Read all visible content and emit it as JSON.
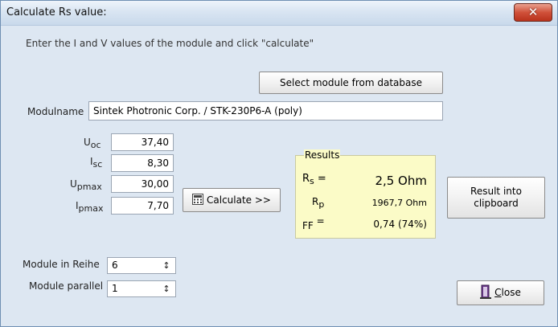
{
  "window": {
    "title": "Calculate Rs value:"
  },
  "instruction": "Enter the I and V values of the module and click \"calculate\"",
  "buttons": {
    "select_module": "Select module from database",
    "calculate": "Calculate >>",
    "result_clipboard_line1": "Result into",
    "result_clipboard_line2": "clipboard",
    "close": "Close",
    "close_mnemonic": "C",
    "close_rest": "lose"
  },
  "module": {
    "label": "Modulname",
    "value": "Sintek Photronic Corp. / STK-230P6-A (poly)"
  },
  "inputs": {
    "uoc": {
      "main": "U",
      "sub": "oc",
      "value": "37,40"
    },
    "isc": {
      "main": "I",
      "sub": "sc",
      "value": "8,30"
    },
    "upmax": {
      "main": "U",
      "sub": "pmax",
      "value": "30,00"
    },
    "ipmax": {
      "main": "I",
      "sub": "pmax",
      "value": "7,70"
    }
  },
  "results": {
    "title": "Results",
    "rs": {
      "main": "R",
      "sub": "s",
      "eq": " =",
      "value": "2,5 Ohm"
    },
    "rp": {
      "main": "R",
      "sub": "p",
      "value": "1967,7 Ohm"
    },
    "ff": {
      "label": "FF",
      "eq": "=",
      "value": "0,74 (74%)"
    }
  },
  "module_counts": {
    "series_label": "Module in Reihe",
    "series_value": "6",
    "parallel_label": "Module parallel",
    "parallel_value": "1"
  }
}
